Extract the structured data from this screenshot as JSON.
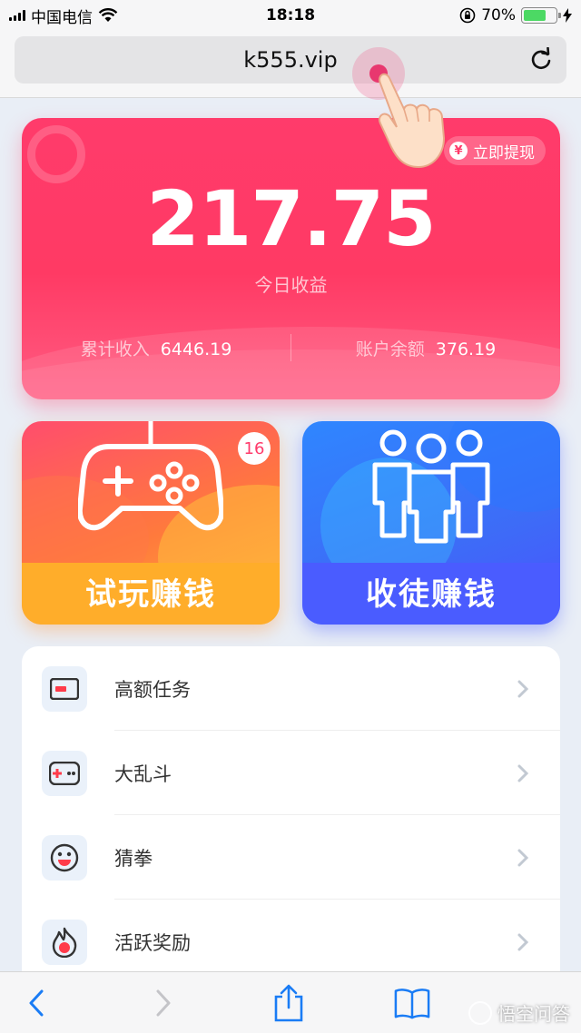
{
  "status_bar": {
    "carrier": "中国电信",
    "time": "18:18",
    "battery_pct": "70%",
    "icons": [
      "signal-icon",
      "wifi-icon",
      "orientation-lock-icon",
      "battery-icon",
      "charging-icon"
    ]
  },
  "browser": {
    "url": "k555.vip",
    "reload_icon": "reload-icon"
  },
  "earnings": {
    "withdraw_label": "立即提现",
    "withdraw_icon_glyph": "¥",
    "today_amount": "217.75",
    "today_label": "今日收益",
    "total_income_label": "累计收入",
    "total_income_value": "6446.19",
    "balance_label": "账户余额",
    "balance_value": "376.19"
  },
  "tiles": {
    "play": {
      "label": "试玩赚钱",
      "badge": "16",
      "icon": "gamepad-icon"
    },
    "recruit": {
      "label": "收徒赚钱",
      "icon": "people-icon"
    }
  },
  "menu": {
    "items": [
      {
        "label": "高额任务",
        "icon": "card-icon"
      },
      {
        "label": "大乱斗",
        "icon": "gamepad-small-icon"
      },
      {
        "label": "猜拳",
        "icon": "smile-icon"
      },
      {
        "label": "活跃奖励",
        "icon": "flame-icon"
      }
    ]
  },
  "toolbar": {
    "icons": [
      "back-icon",
      "forward-icon",
      "share-icon",
      "bookmarks-icon",
      "tabs-icon"
    ]
  },
  "watermark": {
    "text": "悟空问答"
  },
  "colors": {
    "card_pink": "#ff3b6b",
    "tile_orange": "#ffad2a",
    "tile_blue": "#4a5cff",
    "ios_blue": "#1a7cf5"
  }
}
